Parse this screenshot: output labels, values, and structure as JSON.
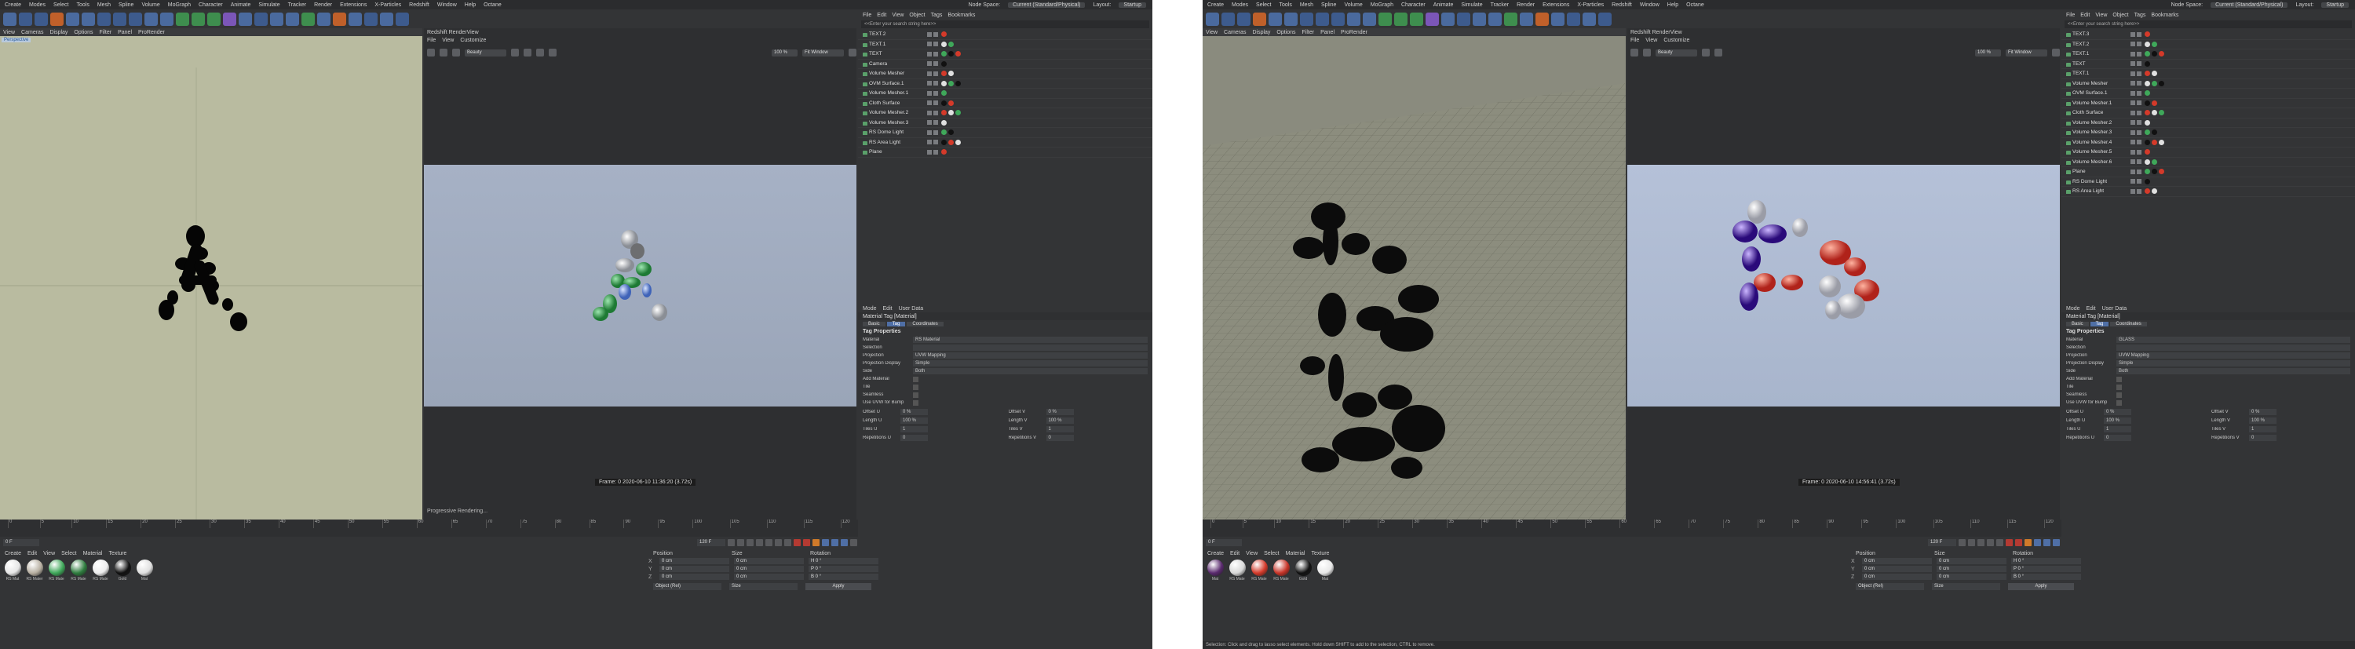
{
  "menus": [
    "Create",
    "Modes",
    "Select",
    "Tools",
    "Mesh",
    "Spline",
    "Volume",
    "MoGraph",
    "Character",
    "Animate",
    "Simulate",
    "Tracker",
    "Render",
    "Extensions",
    "X-Particles",
    "Redshift",
    "Window",
    "Help",
    "Octane"
  ],
  "node_space": {
    "label": "Node Space:",
    "value": "Current (Standard/Physical)"
  },
  "layout": {
    "label": "Layout:",
    "value": "Startup"
  },
  "viewport_menu": [
    "View",
    "Cameras",
    "Display",
    "Options",
    "Filter",
    "Panel",
    "ProRender"
  ],
  "renderview": {
    "title": "Redshift RenderView",
    "menu": [
      "File",
      "View",
      "Customize"
    ],
    "dropdown_beauty": "Beauty",
    "zoom": "100 %",
    "fit": "Fit Window",
    "status": "Progressive Rendering..."
  },
  "left": {
    "viewport_label": "Perspective",
    "frame_info": "Frame: 0  2020-06-10  11:36:20  (3.72s)",
    "grid_spacing": "Grid Spacing : 100 cm",
    "objects": [
      {
        "name": "TEXT.2"
      },
      {
        "name": "TEXT.1"
      },
      {
        "name": "TEXT"
      },
      {
        "name": "Camera"
      },
      {
        "name": "Volume Mesher"
      },
      {
        "name": "OVM Surface.1"
      },
      {
        "name": "Volume Mesher.1"
      },
      {
        "name": "Cloth Surface"
      },
      {
        "name": "Volume Mesher.2"
      },
      {
        "name": "Volume Mesher.3"
      },
      {
        "name": "RS Dome Light"
      },
      {
        "name": "RS Area Light"
      },
      {
        "name": "Plane"
      }
    ]
  },
  "right": {
    "frame_info": "Frame: 0  2020-06-10  14:56:41  (3.72s)",
    "grid_spacing": "Grid Spacing : 10 cm",
    "status_bar": "Selection: Click and drag to lasso select elements. Hold down SHIFT to add to the selection, CTRL to remove.",
    "objects": [
      {
        "name": "TEXT.3"
      },
      {
        "name": "TEXT.2"
      },
      {
        "name": "TEXT.1"
      },
      {
        "name": "TEXT"
      },
      {
        "name": "TEXT.1"
      },
      {
        "name": "Volume Mesher"
      },
      {
        "name": "OVM Surface.1"
      },
      {
        "name": "Volume Mesher.1"
      },
      {
        "name": "Cloth Surface"
      },
      {
        "name": "Volume Mesher.2"
      },
      {
        "name": "Volume Mesher.3"
      },
      {
        "name": "Volume Mesher.4"
      },
      {
        "name": "Volume Mesher.5"
      },
      {
        "name": "Volume Mesher.6"
      },
      {
        "name": "Plane"
      },
      {
        "name": "RS Dome Light"
      },
      {
        "name": "RS Area Light"
      }
    ]
  },
  "object_search": "<<Enter your search string here>>",
  "object_menu": [
    "File",
    "Edit",
    "View",
    "Object",
    "Tags",
    "Bookmarks"
  ],
  "attributes": {
    "menu": [
      "Mode",
      "Edit",
      "User Data"
    ],
    "header": "Material Tag [Material]",
    "tabs": [
      "Basic",
      "Tag",
      "Coordinates"
    ],
    "section": "Tag Properties",
    "rows": [
      {
        "label": "Material",
        "value": "RS Material"
      },
      {
        "label": "Selection",
        "value": ""
      },
      {
        "label": "Projection",
        "value": "UVW Mapping"
      },
      {
        "label": "Projection Display",
        "value": "Simple"
      },
      {
        "label": "Side",
        "value": "Both"
      }
    ],
    "checks": [
      "Add Material",
      "Tile",
      "Seamless",
      "Use UVW for Bump"
    ],
    "grid": [
      {
        "label": "Offset U",
        "value": "0 %"
      },
      {
        "label": "Offset V",
        "value": "0 %"
      },
      {
        "label": "Length U",
        "value": "100 %"
      },
      {
        "label": "Length V",
        "value": "100 %"
      },
      {
        "label": "Tiles U",
        "value": "1"
      },
      {
        "label": "Tiles V",
        "value": "1"
      },
      {
        "label": "Repetitions U",
        "value": "0"
      },
      {
        "label": "Repetitions V",
        "value": "0"
      }
    ],
    "material_right": "GLASS"
  },
  "timeline": {
    "ticks": [
      "0",
      "5",
      "10",
      "15",
      "20",
      "25",
      "30",
      "35",
      "40",
      "45",
      "50",
      "55",
      "60",
      "65",
      "70",
      "75",
      "80",
      "85",
      "90",
      "95",
      "100",
      "105",
      "110",
      "115",
      "120"
    ],
    "start": "0 F",
    "end": "120 F",
    "current": "0 F"
  },
  "materials_menu": [
    "Create",
    "Edit",
    "View",
    "Select",
    "Material",
    "Texture"
  ],
  "left_materials": [
    {
      "name": "RS Mat",
      "color": "#e6e6e6"
    },
    {
      "name": "RS Mater",
      "color": "#b8b0a2"
    },
    {
      "name": "RS Mate",
      "color": "#3fa85a"
    },
    {
      "name": "RS Mate",
      "color": "#2f7d3f"
    },
    {
      "name": "RS Mate",
      "color": "#ededed"
    },
    {
      "name": "Gold",
      "color": "#111111"
    },
    {
      "name": "Mat",
      "color": "#e0e0e0"
    }
  ],
  "right_materials": [
    {
      "name": "Mat",
      "color": "#5a2a6e"
    },
    {
      "name": "RS Mate",
      "color": "#d8d8d8"
    },
    {
      "name": "RS Mate",
      "color": "#d43a2a"
    },
    {
      "name": "RS Mate",
      "color": "#c83428"
    },
    {
      "name": "Gold",
      "color": "#111111"
    },
    {
      "name": "Mat",
      "color": "#e8e8e8"
    }
  ],
  "coordinates": {
    "headers": [
      "Position",
      "Size",
      "Rotation"
    ],
    "rows": [
      {
        "axis": "X",
        "pos": "0 cm",
        "size": "0 cm",
        "rot": "H  0 °"
      },
      {
        "axis": "Y",
        "pos": "0 cm",
        "size": "0 cm",
        "rot": "P  0 °"
      },
      {
        "axis": "Z",
        "pos": "0 cm",
        "size": "0 cm",
        "rot": "B  0 °"
      }
    ],
    "mode": "Object (Rel)",
    "size_mode": "Size",
    "apply": "Apply"
  },
  "colors": {
    "accent": "#4f6fa6",
    "ui_bg": "#333436",
    "viewport_left": "#b9bba0",
    "render_bg": "#a8b3c5",
    "panel_dark": "#2e2f31"
  }
}
